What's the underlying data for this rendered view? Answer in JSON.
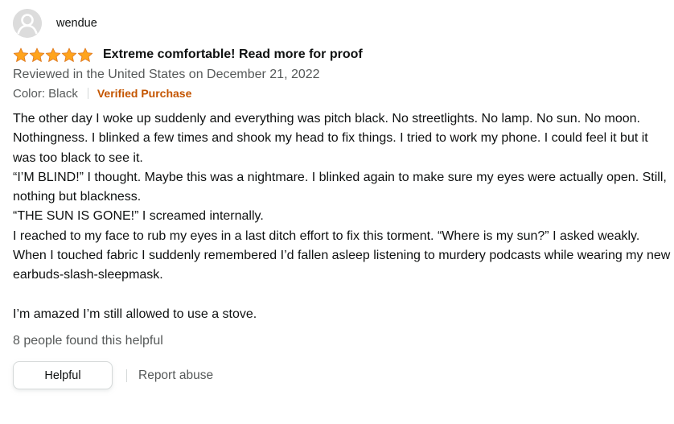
{
  "review": {
    "profile_name": "wendue",
    "rating": 5,
    "rating_max": 5,
    "star_color": "#ffa41c",
    "title": "Extreme comfortable! Read more for proof",
    "date_line": "Reviewed in the United States on December 21, 2022",
    "color_label": "Color: Black",
    "verified_label": "Verified Purchase",
    "body_lines": [
      "The other day I woke up suddenly and everything was pitch black. No streetlights. No lamp. No sun. No moon. Nothingness. I blinked a few times and shook my head to fix things. I tried to work my phone. I could feel it but it was too black to see it.",
      "“I’M BLIND!” I thought. Maybe this was a nightmare. I blinked again to make sure my eyes were actually open. Still, nothing but blackness.",
      "“THE SUN IS GONE!” I screamed internally.",
      "I reached to my face to rub my eyes in a last ditch effort to fix this torment. “Where is my sun?” I asked weakly.",
      "When I touched fabric I suddenly remembered I’d fallen asleep listening to murdery podcasts while wearing my new earbuds-slash-sleepmask.",
      "",
      "I’m amazed I’m still allowed to use a stove."
    ],
    "helpful_count_text": "8 people found this helpful",
    "helpful_button_label": "Helpful",
    "report_label": "Report abuse",
    "icons": {
      "avatar": "user-avatar-icon",
      "star": "star-icon"
    },
    "colors": {
      "verified": "#c45500",
      "secondary_text": "#565959",
      "primary_text": "#0f1111"
    }
  }
}
